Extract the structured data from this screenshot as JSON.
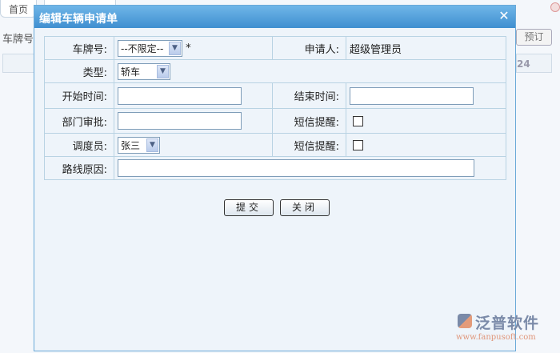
{
  "background": {
    "tab_home": "首页",
    "label_plate": "车牌号",
    "reserve_button": "预订",
    "date_fragment": "24"
  },
  "dialog": {
    "title": "编辑车辆申请单",
    "fields": {
      "plate_label": "车牌号:",
      "plate_value": "--不限定--",
      "required_mark": "*",
      "applicant_label": "申请人:",
      "applicant_value": "超级管理员",
      "type_label": "类型:",
      "type_value": "轿车",
      "start_label": "开始时间:",
      "start_value": "",
      "end_label": "结束时间:",
      "end_value": "",
      "dept_label": "部门审批:",
      "dept_value": "",
      "sms1_label": "短信提醒:",
      "dispatcher_label": "调度员:",
      "dispatcher_value": "张三",
      "sms2_label": "短信提醒:",
      "route_label": "路线原因:",
      "route_value": ""
    },
    "submit_label": "提交",
    "close_label": "关闭"
  },
  "watermark": {
    "brand": "泛普软件",
    "url": "www.fanpusoft.com"
  }
}
